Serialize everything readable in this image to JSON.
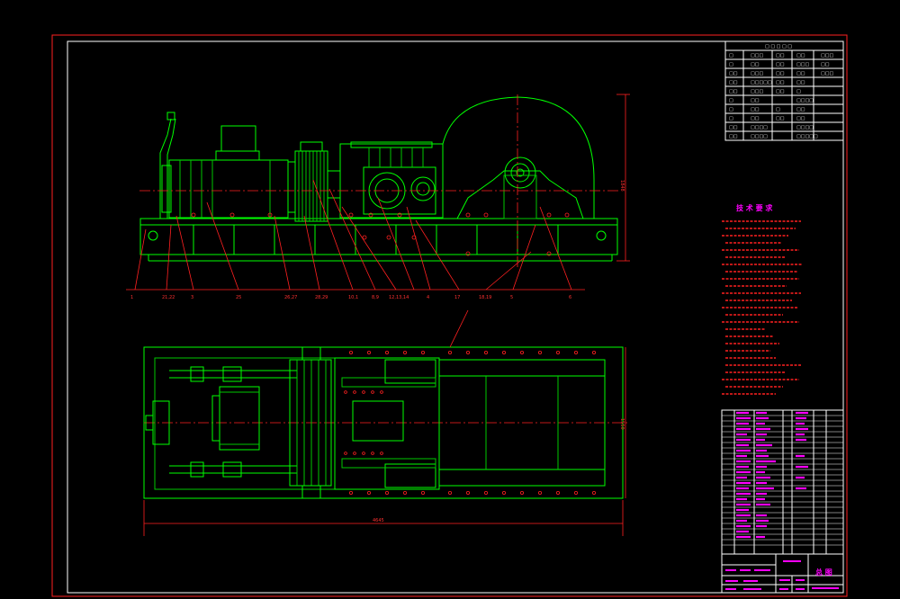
{
  "drawing": {
    "technical_requirements_title": "技 术 要 求",
    "title_block_name": "总 图",
    "part_labels": [
      "1",
      "2",
      "3",
      "4",
      "5",
      "6"
    ]
  },
  "colors": {
    "background": "#000000",
    "geometry": "#00ff00",
    "frame": "#ffffff",
    "dimensions": "#ff2020",
    "annotations": "#ff00ff"
  }
}
